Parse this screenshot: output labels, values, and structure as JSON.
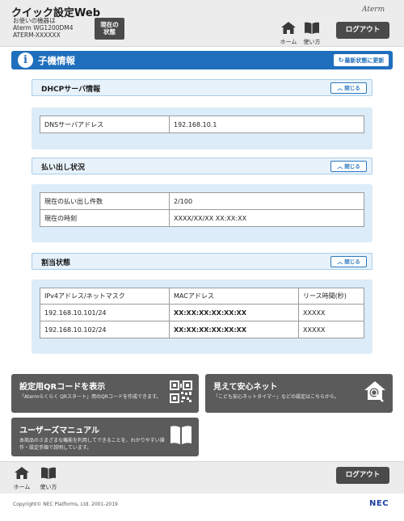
{
  "header": {
    "app_title": "クイック設定Web",
    "device_intro": "お使いの機器は",
    "device_model": "Aterm WG1200DM4",
    "device_ssid": "ATERM-XXXXXX",
    "status_button": [
      "現在の",
      "状態"
    ],
    "brand_logo": "Aterm",
    "home_label": "ホーム",
    "guide_label": "使い方",
    "logout_label": "ログアウト"
  },
  "page": {
    "title": "子機情報",
    "refresh_label": "最新状態に更新"
  },
  "sections": {
    "dhcp": {
      "title": "DHCPサーバ情報",
      "close_label": "閉じる",
      "rows": [
        {
          "key": "DNSサーバアドレス",
          "value": "192.168.10.1"
        }
      ]
    },
    "lease": {
      "title": "払い出し状況",
      "close_label": "閉じる",
      "rows": [
        {
          "key": "現在の払い出し件数",
          "value": "2/100"
        },
        {
          "key": "現在の時刻",
          "value": "XXXX/XX/XX XX:XX:XX"
        }
      ]
    },
    "assign": {
      "title": "割当状態",
      "close_label": "閉じる",
      "columns": [
        "IPv4アドレス/ネットマスク",
        "MACアドレス",
        "リース時間(秒)"
      ],
      "rows": [
        [
          "192.168.10.101/24",
          "XX:XX:XX:XX:XX:XX",
          "XXXXX"
        ],
        [
          "192.168.10.102/24",
          "XX:XX:XX:XX:XX:XX",
          "XXXXX"
        ]
      ]
    }
  },
  "tiles": {
    "qr": {
      "title": "設定用QRコードを表示",
      "desc": "「Atermらくらく QRスタート」用のQRコードを作成できます。"
    },
    "safe": {
      "title": "見えて安心ネット",
      "desc": "「こども安心ネットタイマー」などの設定はこちらから。"
    },
    "manual": {
      "title": "ユーザーズマニュアル",
      "desc": "本商品のさまざまな機能を利用してできることを、わかりやすい操作・設定手順で説明しています。"
    }
  },
  "footer": {
    "home_label": "ホーム",
    "guide_label": "使い方",
    "logout_label": "ログアウト",
    "copyright": "Copyright© NEC Platforms, Ltd. 2001-2019",
    "company_logo": "NEC"
  },
  "colors": {
    "title_bar": "#1f6fbd",
    "section_body": "#dcecf8",
    "section_head": "#e7f2fb",
    "dark_button": "#4a4a4a",
    "tile": "#5b5b5b",
    "brand_blue": "#1b3fa0"
  }
}
